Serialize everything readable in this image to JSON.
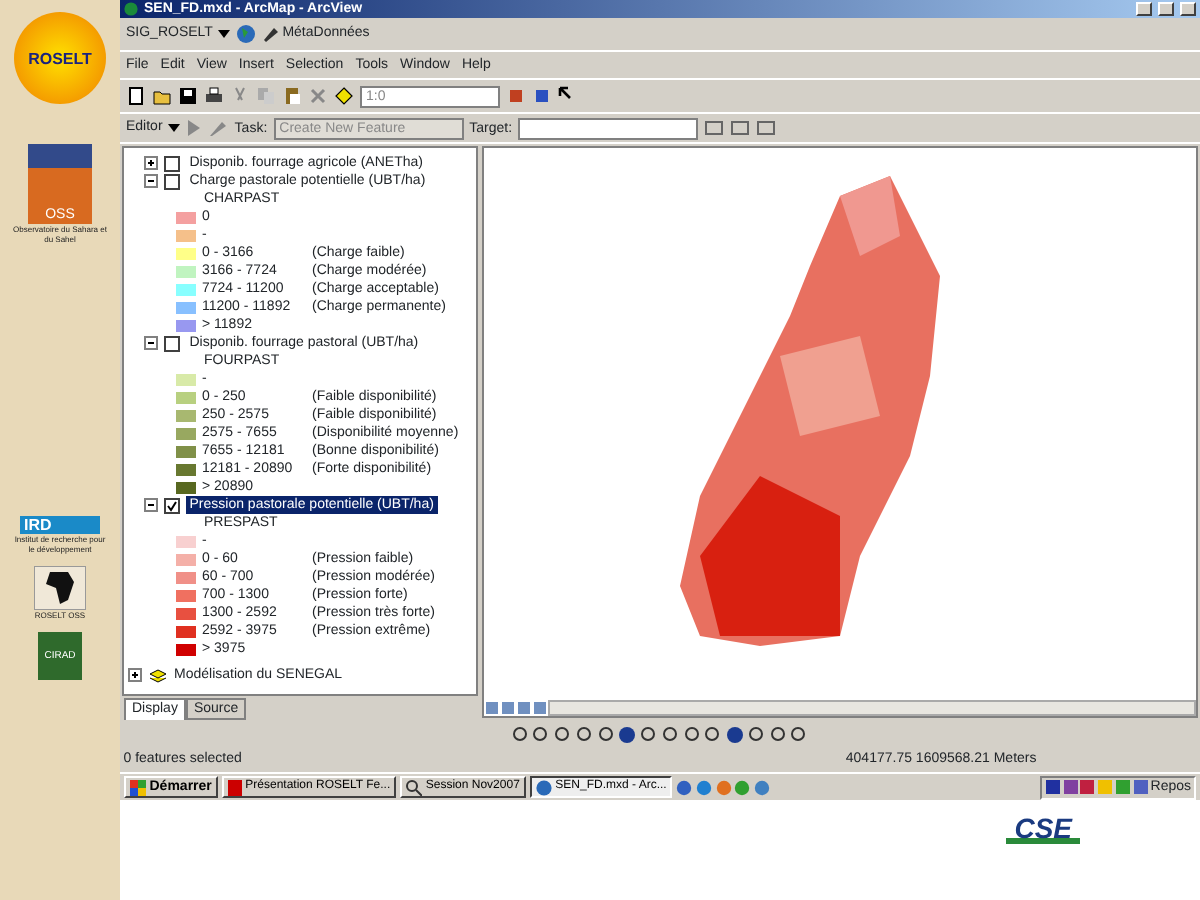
{
  "sidebar": {
    "logos": [
      {
        "kind": "roselt",
        "label": "ROSELT"
      },
      {
        "kind": "oss",
        "label": "OSS",
        "caption": "Observatoire du Sahara et du Sahel"
      },
      {
        "kind": "ird",
        "label": "IRD",
        "caption": "Institut de recherche pour le développement"
      },
      {
        "kind": "africa",
        "label": "ROSELT OSS"
      },
      {
        "kind": "cirad",
        "label": "CIRAD"
      }
    ]
  },
  "window": {
    "title": "SEN_FD.mxd - ArcMap - ArcView"
  },
  "custom_toolbar": {
    "dropdown": "SIG_ROSELT",
    "button": "MétaDonnées"
  },
  "menu": [
    "File",
    "Edit",
    "View",
    "Insert",
    "Selection",
    "Tools",
    "Window",
    "Help"
  ],
  "standard_toolbar": {
    "scale": "1:0"
  },
  "editor_toolbar": {
    "menu": "Editor",
    "task_label": "Task:",
    "task_value": "Create New Feature",
    "target_label": "Target:"
  },
  "toc": {
    "layers": [
      {
        "name": "Disponib. fourrage agricole (ANETha)",
        "checked": false,
        "expanded": false,
        "selected": false
      },
      {
        "name": "Charge pastorale potentielle (UBT/ha)",
        "checked": false,
        "expanded": true,
        "selected": false,
        "field": "CHARPAST",
        "classes": [
          {
            "color": "#f4a0a0",
            "label": "0"
          },
          {
            "color": "#f5c08a",
            "label": "-"
          },
          {
            "color": "#ffff88",
            "label": "0 - 3166",
            "note": "(Charge faible)"
          },
          {
            "color": "#c0f4c0",
            "label": "3166 - 7724",
            "note": "(Charge modérée)"
          },
          {
            "color": "#88ffff",
            "label": "7724 - 11200",
            "note": "(Charge acceptable)"
          },
          {
            "color": "#88c0ff",
            "label": "11200 - 11892",
            "note": "(Charge permanente)"
          },
          {
            "color": "#9898f0",
            "label": "> 11892"
          }
        ]
      },
      {
        "name": "Disponib. fourrage pastoral (UBT/ha)",
        "checked": false,
        "expanded": true,
        "selected": false,
        "field": "FOURPAST",
        "classes": [
          {
            "color": "#d8eaa8",
            "label": "-"
          },
          {
            "color": "#b8d080",
            "label": "0 - 250",
            "note": "(Faible disponibilité)"
          },
          {
            "color": "#a8b870",
            "label": "250 - 2575",
            "note": "(Faible disponibilité)"
          },
          {
            "color": "#98a860",
            "label": "2575 - 7655",
            "note": "(Disponibilité moyenne)"
          },
          {
            "color": "#809048",
            "label": "7655 - 12181",
            "note": "(Bonne disponibilité)"
          },
          {
            "color": "#687830",
            "label": "12181 - 20890",
            "note": "(Forte disponibilité)"
          },
          {
            "color": "#586820",
            "label": "> 20890"
          }
        ]
      },
      {
        "name": "Pression pastorale potentielle (UBT/ha)",
        "checked": true,
        "expanded": true,
        "selected": true,
        "field": "PRESPAST",
        "classes": [
          {
            "color": "#f8d0d0",
            "label": "-"
          },
          {
            "color": "#f4b0a8",
            "label": "0 - 60",
            "note": "(Pression faible)"
          },
          {
            "color": "#f09088",
            "label": "60 - 700",
            "note": "(Pression modérée)"
          },
          {
            "color": "#f07060",
            "label": "700 - 1300",
            "note": "(Pression forte)"
          },
          {
            "color": "#e85040",
            "label": "1300 - 2592",
            "note": "(Pression très forte)"
          },
          {
            "color": "#e03020",
            "label": "2592 - 3975",
            "note": "(Pression extrême)"
          },
          {
            "color": "#d00000",
            "label": "> 3975"
          }
        ]
      }
    ],
    "group": {
      "name": "Modélisation du SENEGAL",
      "expanded": false
    },
    "tabs": [
      {
        "label": "Display",
        "selected": true
      },
      {
        "label": "Source",
        "selected": false
      }
    ]
  },
  "status_bar": {
    "left": "0 features selected",
    "coordinates": "404177.75  1609568.21 Meters"
  },
  "taskbar": {
    "start": "Démarrer",
    "tasks": [
      {
        "label": "Présentation ROSELT Fe...",
        "kind": "pdf",
        "selected": false
      },
      {
        "label": "Session Nov2007",
        "kind": "search",
        "selected": false
      },
      {
        "label": "SEN_FD.mxd - Arc...",
        "kind": "globe",
        "selected": true
      }
    ],
    "clock": "Repos"
  },
  "footer": {
    "logo": "CSE"
  }
}
